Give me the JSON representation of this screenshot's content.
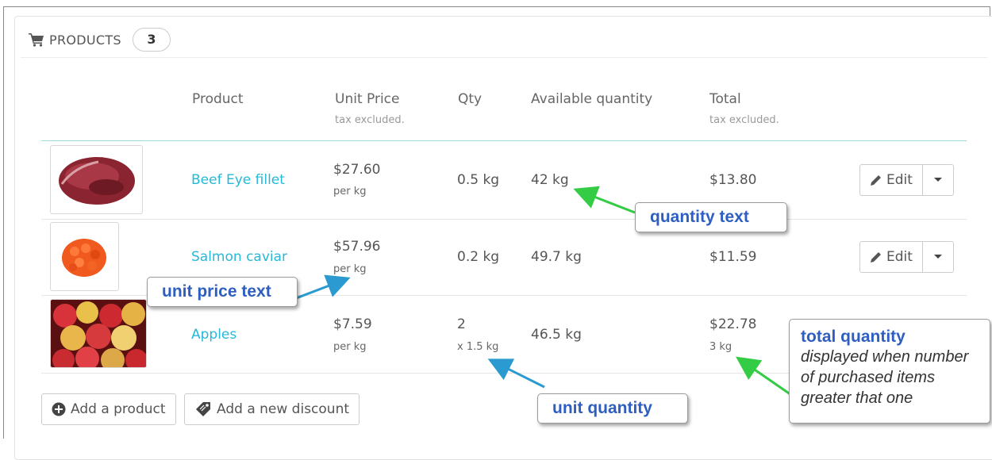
{
  "panel": {
    "heading": "PRODUCTS",
    "count": "3"
  },
  "table": {
    "columns": [
      {
        "label": "Product",
        "sub": ""
      },
      {
        "label": "Unit Price",
        "sub": "tax excluded."
      },
      {
        "label": "Qty",
        "sub": ""
      },
      {
        "label": "Available quantity",
        "sub": ""
      },
      {
        "label": "Total",
        "sub": "tax excluded."
      }
    ],
    "rows": [
      {
        "name": "Beef Eye fillet",
        "unit_price": "$27.60",
        "unit_price_sub": "per kg",
        "qty": "0.5 kg",
        "qty_sub": "",
        "available": "42 kg",
        "total": "$13.80",
        "total_sub": "",
        "edit_label": "Edit"
      },
      {
        "name": "Salmon caviar",
        "unit_price": "$57.96",
        "unit_price_sub": "per kg",
        "qty": "0.2 kg",
        "qty_sub": "",
        "available": "49.7 kg",
        "total": "$11.59",
        "total_sub": "",
        "edit_label": "Edit"
      },
      {
        "name": "Apples",
        "unit_price": "$7.59",
        "unit_price_sub": "per kg",
        "qty": "2",
        "qty_sub": "x 1.5 kg",
        "available": "46.5 kg",
        "total": "$22.78",
        "total_sub": "3 kg",
        "edit_label": ""
      }
    ]
  },
  "footer": {
    "add_product": "Add a product",
    "add_discount": "Add a new discount"
  },
  "callouts": {
    "quantity_text": "quantity text",
    "unit_price_text": "unit price text",
    "unit_quantity": "unit quantity",
    "total_quantity_title": "total quantity",
    "total_quantity_desc": "displayed when number of purchased items greater that one"
  },
  "colors": {
    "link": "#25b9d7",
    "callout_text": "#2e5fc0",
    "arrow_green": "#33cc44",
    "arrow_blue": "#2a9ad0"
  },
  "icons": [
    "shopping-cart-icon",
    "pencil-icon",
    "caret-down-icon",
    "plus-circle-icon",
    "ticket-icon"
  ]
}
